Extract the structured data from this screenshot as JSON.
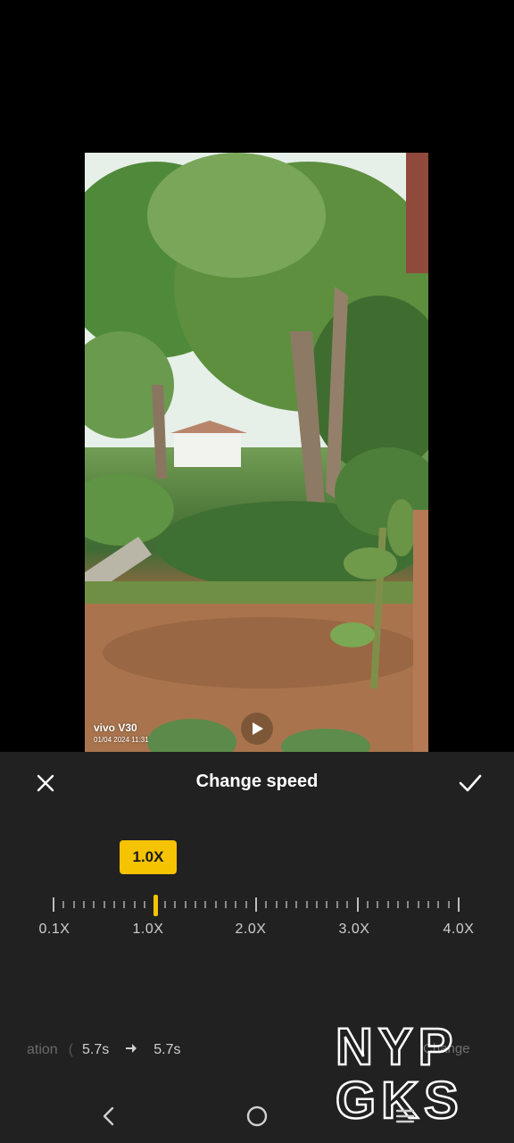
{
  "editor": {
    "title": "Change speed",
    "close_icon": "close-icon",
    "confirm_icon": "checkmark-icon"
  },
  "preview": {
    "watermark_brand": "vivo V30",
    "watermark_date": "01/04 2024 11:31",
    "play_icon": "play-icon"
  },
  "speed": {
    "current": "1.0X",
    "current_value": 1.0,
    "min": 0.1,
    "max": 4.0,
    "labels": [
      "0.1X",
      "1.0X",
      "2.0X",
      "3.0X",
      "4.0X"
    ],
    "accent_color": "#f6c300"
  },
  "duration": {
    "label_partial": "ation",
    "divider_partial": "(",
    "from": "5.7s",
    "to": "5.7s",
    "arrow_icon": "arrow-right-icon"
  },
  "change_all_partial": "Change",
  "overlay_logo": {
    "line1": "NYP",
    "line2": "GKS"
  },
  "navbar": {
    "back_icon": "nav-back-icon",
    "home_icon": "nav-home-icon",
    "recent_icon": "nav-recents-icon"
  }
}
